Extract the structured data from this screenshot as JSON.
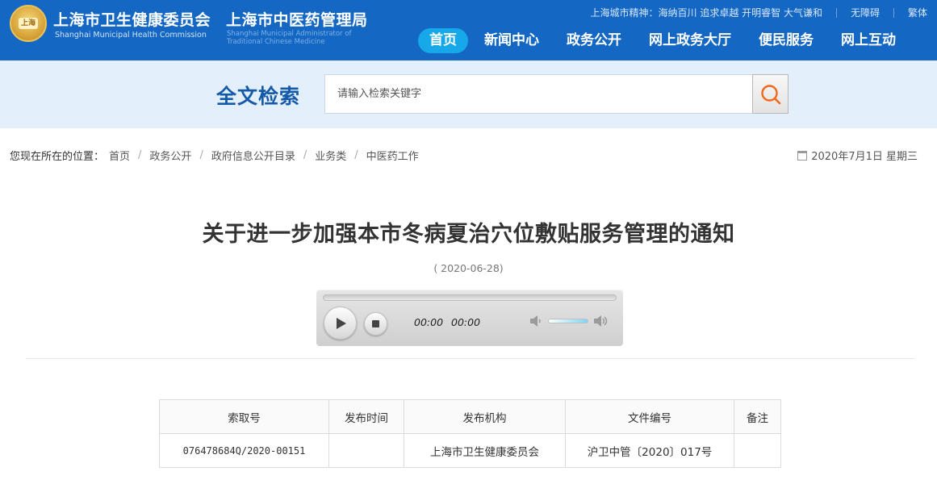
{
  "header": {
    "emblem_text": "上海",
    "org1_name": "上海市卫生健康委员会",
    "org1_en": "Shanghai Municipal Health Commission",
    "org2_name": "上海市中医药管理局",
    "org2_en": "Shanghai Municipal Administrator of Traditional Chinese Medicine",
    "city_spirit": "上海城市精神：海纳百川 追求卓越 开明睿智 大气谦和",
    "accessibility": "无障碍",
    "traditional": "繁体",
    "nav": [
      {
        "label": "首页",
        "active": true
      },
      {
        "label": "新闻中心",
        "active": false
      },
      {
        "label": "政务公开",
        "active": false
      },
      {
        "label": "网上政务大厅",
        "active": false
      },
      {
        "label": "便民服务",
        "active": false
      },
      {
        "label": "网上互动",
        "active": false
      }
    ],
    "colors": {
      "header_bg": "#1467c3",
      "active_nav": "#16a8e8"
    }
  },
  "search": {
    "title": "全文检索",
    "placeholder": "请输入检索关键字",
    "button_icon": "search-icon"
  },
  "breadcrumb": {
    "lead": "您现在所在的位置：",
    "items": [
      "首页",
      "政务公开",
      "政府信息公开目录",
      "业务类",
      "中医药工作"
    ],
    "separator": "/"
  },
  "today": {
    "icon": "calendar-icon",
    "text": "2020年7月1日 星期三"
  },
  "document": {
    "title": "关于进一步加强本市冬病夏治穴位敷贴服务管理的通知",
    "date": "( 2020-06-28)"
  },
  "player": {
    "current_time": "00:00",
    "duration": "00:00",
    "volume_level": 0.6,
    "progress": 0
  },
  "meta_table": {
    "headers": [
      "索取号",
      "发布时间",
      "发布机构",
      "文件编号",
      "备注"
    ],
    "row": [
      "076478684Q/2020-00151",
      "",
      "上海市卫生健康委员会",
      "沪卫中管〔2020〕017号",
      ""
    ]
  }
}
